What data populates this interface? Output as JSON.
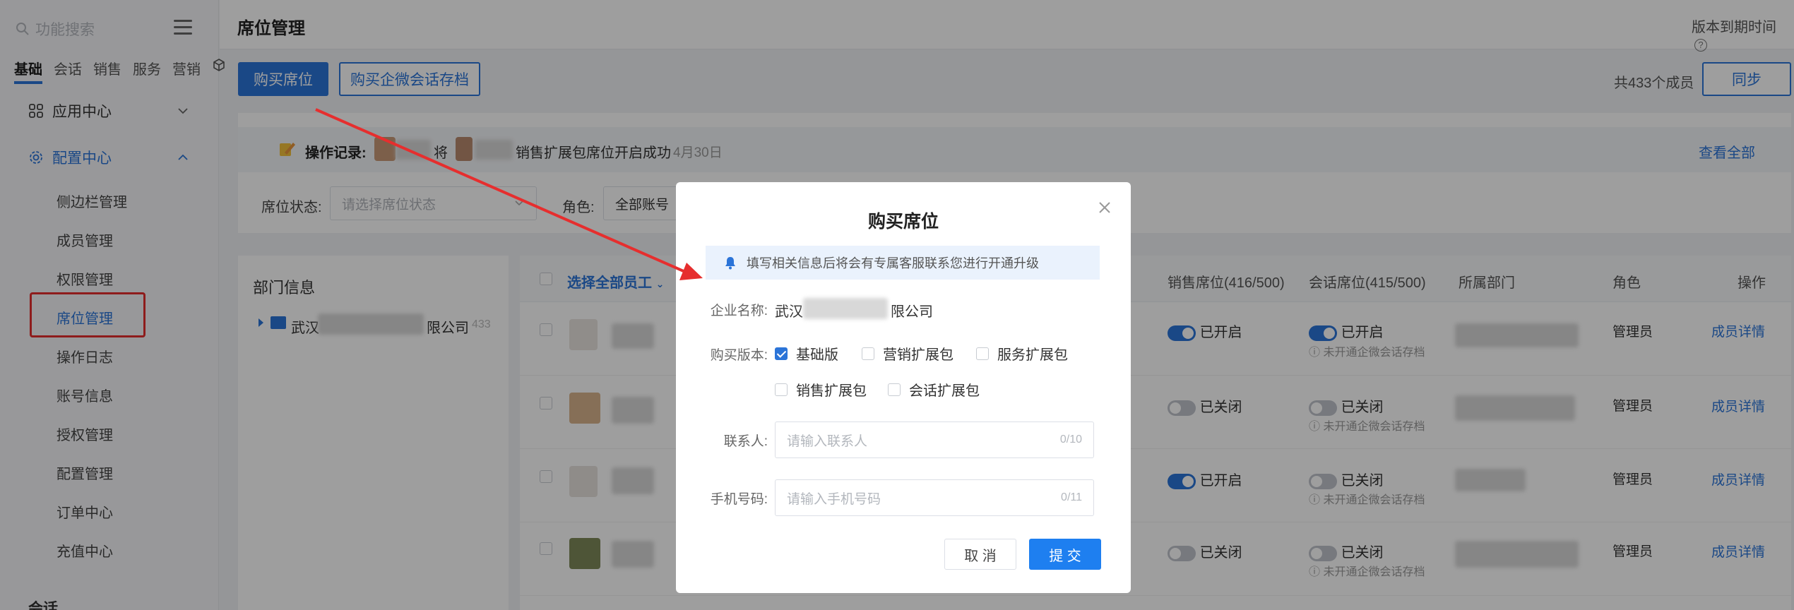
{
  "sidebar": {
    "search_placeholder": "功能搜索",
    "tabs": [
      "基础",
      "会话",
      "销售",
      "服务",
      "营销"
    ],
    "groups": {
      "app_center": "应用中心",
      "config_center": "配置中心",
      "session": "会话"
    },
    "items": [
      "侧边栏管理",
      "成员管理",
      "权限管理",
      "席位管理",
      "操作日志",
      "账号信息",
      "授权管理",
      "配置管理",
      "订单中心",
      "充值中心"
    ]
  },
  "header": {
    "title": "席位管理",
    "expiry": "版本到期时间"
  },
  "toolbar": {
    "buy_seat": "购买席位",
    "buy_archive": "购买企微会话存档",
    "member_count": "共433个成员",
    "sync": "同步"
  },
  "operation_log": {
    "label": "操作记录:",
    "action_word": "将",
    "message": "销售扩展包席位开启成功",
    "date": "4月30日",
    "view_all": "查看全部"
  },
  "filters": {
    "status_label": "席位状态:",
    "status_placeholder": "请选择席位状态",
    "role_label": "角色:",
    "role_value": "全部账号"
  },
  "dept": {
    "title": "部门信息",
    "company_prefix": "武汉",
    "company_suffix": "限公司",
    "count": "433"
  },
  "table": {
    "select_all": "选择全部员工",
    "columns": [
      "销售席位(416/500)",
      "会话席位(415/500)",
      "所属部门",
      "角色",
      "操作"
    ],
    "rows": [
      {
        "sales": "已开启",
        "sales_on": true,
        "session": "已开启",
        "session_on": true,
        "note": "未开通企微会话存档",
        "role": "管理员",
        "action": "成员详情"
      },
      {
        "sales": "已关闭",
        "sales_on": false,
        "session": "已关闭",
        "session_on": false,
        "note": "未开通企微会话存档",
        "role": "管理员",
        "action": "成员详情"
      },
      {
        "sales": "已开启",
        "sales_on": true,
        "session": "已关闭",
        "session_on": false,
        "note": "未开通企微会话存档",
        "role": "管理员",
        "action": "成员详情"
      },
      {
        "sales": "已关闭",
        "sales_on": false,
        "session": "已关闭",
        "session_on": false,
        "note": "未开通企微会话存档",
        "role": "管理员",
        "action": "成员详情"
      }
    ]
  },
  "modal": {
    "title": "购买席位",
    "notice": "填写相关信息后将会有专属客服联系您进行开通升级",
    "company_label": "企业名称:",
    "company_prefix": "武汉",
    "company_suffix": "限公司",
    "version_label": "购买版本:",
    "options": [
      {
        "label": "基础版",
        "checked": true
      },
      {
        "label": "营销扩展包",
        "checked": false
      },
      {
        "label": "服务扩展包",
        "checked": false
      },
      {
        "label": "销售扩展包",
        "checked": false
      },
      {
        "label": "会话扩展包",
        "checked": false
      }
    ],
    "contact_label": "联系人:",
    "contact_placeholder": "请输入联系人",
    "contact_count": "0/10",
    "phone_label": "手机号码:",
    "phone_placeholder": "请输入手机号码",
    "phone_count": "0/11",
    "cancel": "取 消",
    "submit": "提 交"
  },
  "colors": {
    "primary": "#2b74d8",
    "submit": "#1e7ff0",
    "highlight": "#e62e2e"
  }
}
